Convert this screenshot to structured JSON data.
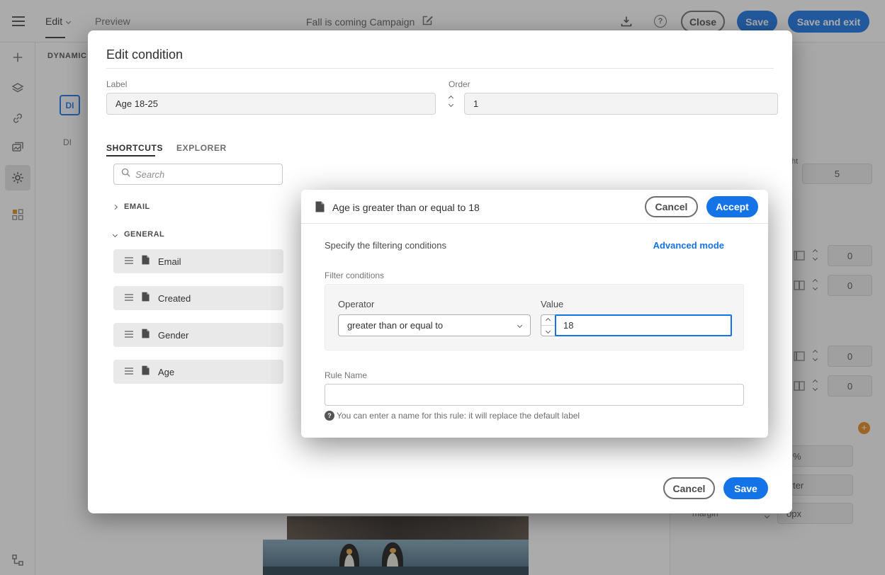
{
  "colors": {
    "accent": "#1473E6"
  },
  "topbar": {
    "tabs": [
      {
        "label": "Edit"
      },
      {
        "label": "Preview"
      }
    ],
    "title": "Fall is coming Campaign",
    "help_glyph": "?",
    "buttons": {
      "close": "Close",
      "save": "Save",
      "save_and_exit": "Save and exit"
    }
  },
  "canvas": {
    "dynamic_label": "DYNAMIC",
    "di_badges": [
      "DI",
      "DI"
    ],
    "right_panel": {
      "height_label": "ht",
      "height_value": "5",
      "zeros": [
        "0",
        "0",
        "0",
        "0"
      ],
      "percent": "%",
      "align_fragment": "ter",
      "margin_label": "margin",
      "margin_value": "0px"
    }
  },
  "edit_condition": {
    "title": "Edit condition",
    "label_field": {
      "label": "Label",
      "value": "Age 18-25"
    },
    "order_field": {
      "label": "Order",
      "value": "1"
    },
    "tabs": {
      "shortcuts": "SHORTCUTS",
      "explorer": "EXPLORER"
    },
    "search_placeholder": "Search",
    "tree": {
      "email_group": "EMAIL",
      "general_group": "GENERAL",
      "items": [
        "Email",
        "Created",
        "Gender",
        "Age"
      ]
    },
    "buttons": {
      "cancel": "Cancel",
      "save": "Save"
    }
  },
  "rule_editor": {
    "title": "Age is greater than or equal to 18",
    "buttons": {
      "cancel": "Cancel",
      "accept": "Accept"
    },
    "subtitle": "Specify the filtering conditions",
    "advanced_mode": "Advanced mode",
    "section_label": "Filter conditions",
    "operator": {
      "label": "Operator",
      "value": "greater than or equal to"
    },
    "value": {
      "label": "Value",
      "value": "18"
    },
    "rule_name_label": "Rule Name",
    "hint_glyph": "?",
    "hint": "You can enter a name for this rule: it will replace the default label"
  }
}
